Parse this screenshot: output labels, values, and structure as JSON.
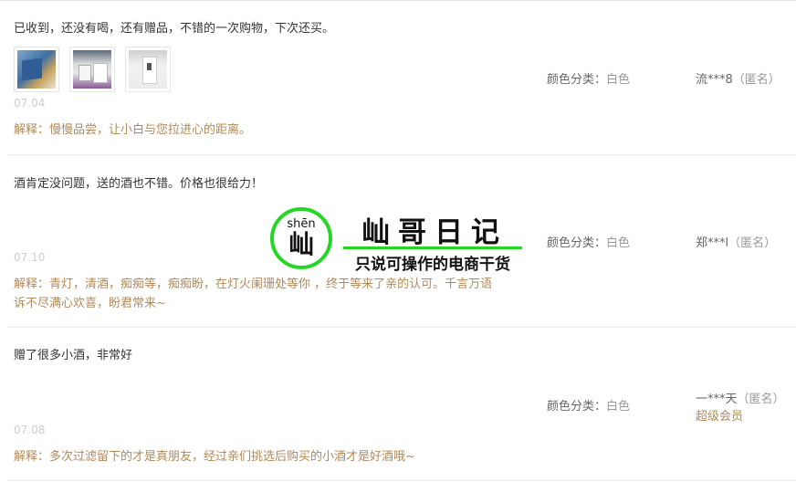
{
  "reviews": [
    {
      "content": "已收到，还没有喝，还有赠品，不错的一次购物，下次还买。",
      "photos": [
        "photo-1",
        "photo-2",
        "photo-3"
      ],
      "date": "07.04",
      "reply_prefix": "解释：",
      "reply_lines": [
        "慢慢品尝，让小白与您拉进心的距离。"
      ],
      "sku_label": "颜色分类：",
      "sku_value": "白色",
      "user": "流***8",
      "anon": "（匿名）",
      "member": ""
    },
    {
      "content": "酒肯定没问题，送的酒也不错。价格也很给力！",
      "photos": [],
      "date": "07.10",
      "reply_prefix": "解释：",
      "reply_lines": [
        "青灯，清酒，痴痴等，痴痴盼，在灯火阑珊处等你 ，终于等来了亲的认可。千言万语",
        "诉不尽满心欢喜，盼君常来~"
      ],
      "sku_label": "颜色分类：",
      "sku_value": "白色",
      "user": "郑***l",
      "anon": "（匿名）",
      "member": ""
    },
    {
      "content": "赠了很多小酒，非常好",
      "photos": [],
      "date": "07.08",
      "reply_prefix": "解释：",
      "reply_lines": [
        "多次过滤留下的才是真朋友，经过亲们挑选后购买的小酒才是好酒哦~"
      ],
      "sku_label": "颜色分类：",
      "sku_value": "白色",
      "user": "一***天",
      "anon": "（匿名）",
      "member": "超级会员"
    }
  ],
  "watermark": {
    "pinyin": "shēn",
    "char": "屾",
    "title": "屾哥日记",
    "subtitle": "只说可操作的电商干货"
  },
  "colors": {
    "reply": "#b08a5a",
    "date": "#cccccc",
    "watermark_green": "#25d625"
  }
}
